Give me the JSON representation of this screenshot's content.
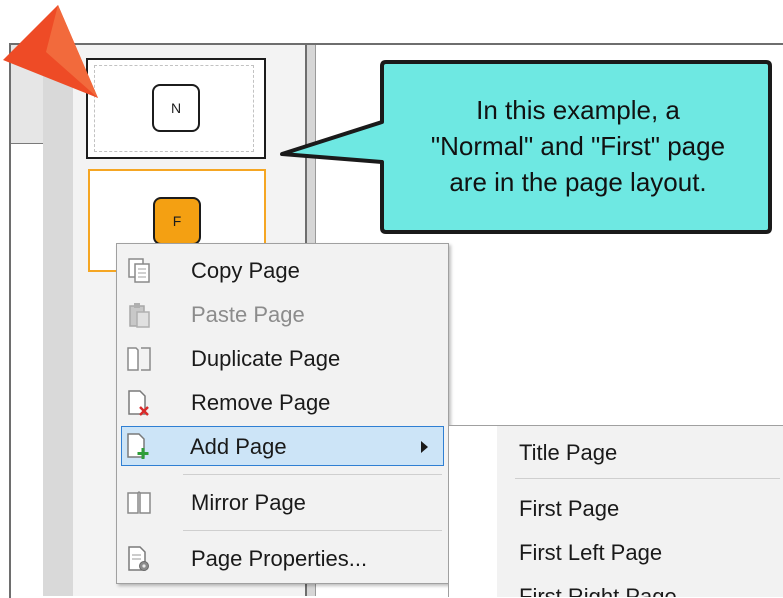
{
  "thumbnails": [
    {
      "letter": "N",
      "page_type": "Normal"
    },
    {
      "letter": "F",
      "page_type": "First"
    }
  ],
  "callout": {
    "lines": [
      "In this example, a",
      "\"Normal\" and \"First\" page",
      "are in the page layout."
    ]
  },
  "context_menu": {
    "items": [
      {
        "label": "Copy Page",
        "icon": "copy-page-icon",
        "enabled": true
      },
      {
        "label": "Paste Page",
        "icon": "paste-page-icon",
        "enabled": false
      },
      {
        "label": "Duplicate Page",
        "icon": "duplicate-page-icon",
        "enabled": true
      },
      {
        "label": "Remove Page",
        "icon": "remove-page-icon",
        "enabled": true
      },
      {
        "label": "Add Page",
        "icon": "add-page-icon",
        "enabled": true,
        "highlighted": true,
        "has_submenu": true
      },
      {
        "label": "Mirror Page",
        "icon": "mirror-page-icon",
        "enabled": true
      },
      {
        "label": "Page Properties...",
        "icon": "page-properties-icon",
        "enabled": true
      }
    ]
  },
  "submenu": {
    "items": [
      "Title Page",
      "First Page",
      "First Left Page",
      "First Right Page"
    ]
  },
  "colors": {
    "callout_fill": "#6ee8e2",
    "callout_border": "#1a1a1a",
    "pointer_orange": "#ee4b26",
    "first_page_badge": "#f4a012",
    "menu_highlight": "#cce4f7"
  }
}
